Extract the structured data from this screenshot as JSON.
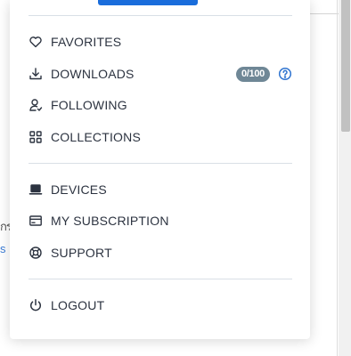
{
  "background": {
    "edge_text": "กร",
    "edge_link": "s"
  },
  "menu": {
    "sections": [
      {
        "items": [
          {
            "id": "favorites",
            "label": "FAVORITES",
            "icon": "heart-icon"
          },
          {
            "id": "downloads",
            "label": "DOWNLOADS",
            "icon": "download-icon",
            "badge": "0/100",
            "help_icon": "help-circle-icon"
          },
          {
            "id": "following",
            "label": "FOLLOWING",
            "icon": "user-follow-icon"
          },
          {
            "id": "collections",
            "label": "COLLECTIONS",
            "icon": "grid-icon"
          }
        ]
      },
      {
        "items": [
          {
            "id": "devices",
            "label": "DEVICES",
            "icon": "laptop-icon"
          },
          {
            "id": "subscription",
            "label": "MY SUBSCRIPTION",
            "icon": "credit-card-icon"
          },
          {
            "id": "support",
            "label": "SUPPORT",
            "icon": "lifebuoy-icon"
          }
        ]
      },
      {
        "items": [
          {
            "id": "logout",
            "label": "LOGOUT",
            "icon": "power-icon"
          }
        ]
      }
    ]
  },
  "colors": {
    "accent": "#1a6ddb",
    "text": "#2c3340",
    "badge_bg": "#6f8796",
    "help_icon": "#2f74d0",
    "divider": "#d9dfe6"
  }
}
